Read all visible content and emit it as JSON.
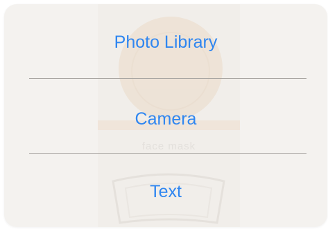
{
  "action_sheet": {
    "options": [
      {
        "label": "Photo Library"
      },
      {
        "label": "Camera"
      },
      {
        "label": "Text"
      }
    ]
  },
  "background": {
    "label": "face mask"
  },
  "colors": {
    "accent": "#2f86f0",
    "sheet": "#f4f2ef",
    "divider": "#a9a6a2"
  }
}
